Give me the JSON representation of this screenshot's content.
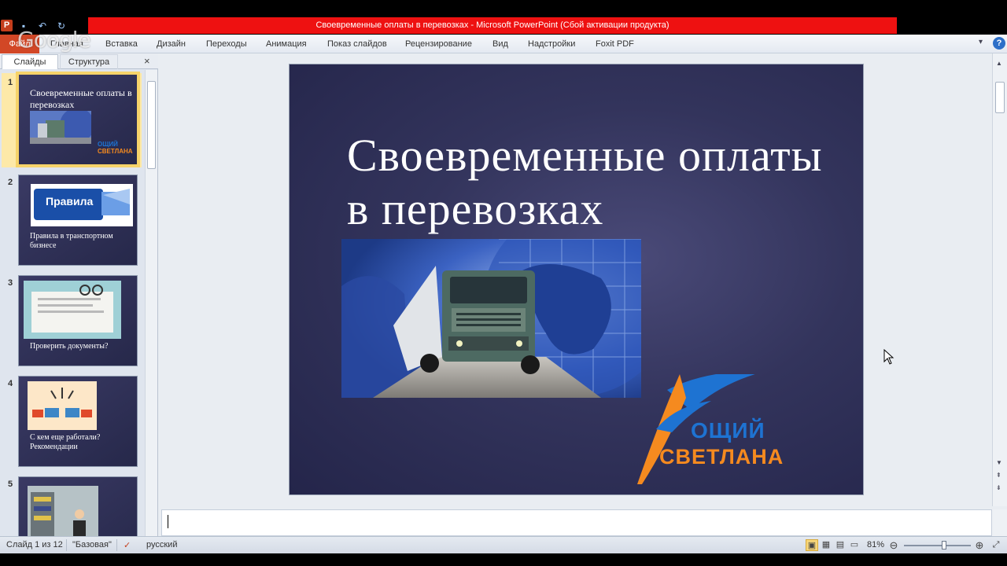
{
  "window": {
    "title": "Своевременные оплаты в перевозках  -  Microsoft PowerPoint (Сбой активации продукта)",
    "app_icon_letter": "P",
    "overlay_logo": "Google"
  },
  "quick_access": [
    "save-icon",
    "undo-icon",
    "redo-icon"
  ],
  "ribbon": {
    "file_tab": "Файл",
    "tabs": [
      "Главная",
      "Вставка",
      "Дизайн",
      "Переходы",
      "Анимация",
      "Показ слайдов",
      "Рецензирование",
      "Вид",
      "Надстройки",
      "Foxit PDF"
    ],
    "help": "?"
  },
  "left_pane": {
    "tab_slides": "Слайды",
    "tab_outline": "Структура",
    "close": "×",
    "thumbnails": [
      {
        "num": "1",
        "title": "Своевременные оплаты в перевозках",
        "logo_line1": "ОЩИЙ",
        "logo_line2": "СВЕТЛАНА"
      },
      {
        "num": "2",
        "banner": "Правила",
        "caption": "Правила в транспортном бизнесе"
      },
      {
        "num": "3",
        "caption": "Проверить документы?"
      },
      {
        "num": "4",
        "caption": "С кем еще работали? Рекомендации"
      },
      {
        "num": "5",
        "caption": ""
      }
    ]
  },
  "slide": {
    "title": "Своевременные оплаты в перевозках",
    "logo_line1": "ОЩИЙ",
    "logo_line2": "СВЕТЛАНА"
  },
  "status": {
    "slide_counter": "Слайд 1 из 12",
    "theme": "\"Базовая\"",
    "language": "русский",
    "zoom": "81%",
    "zoom_level": 0.6
  },
  "colors": {
    "title_banner": "#ee1111",
    "file_tab": "#d24726",
    "slide_bg": "#33345c",
    "logo_orange": "#f58a1f",
    "logo_blue": "#1e73d2"
  }
}
